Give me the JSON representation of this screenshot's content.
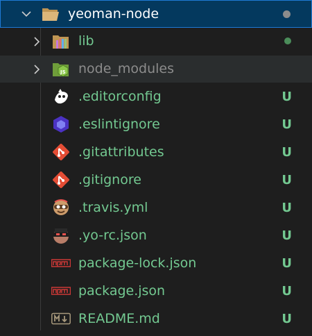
{
  "colors": {
    "modified": "#73c991",
    "ignored": "#8c8c8c",
    "root_text": "#ffffff",
    "selection": "#04395e",
    "focus_border": "#1e7ad6",
    "folder": "#dcb67a"
  },
  "root": {
    "label": "yeoman-node",
    "icon": "folder-open-icon"
  },
  "items": [
    {
      "label": "lib",
      "type": "folder",
      "icon": "lib-folder-icon",
      "status": "",
      "dot": true
    },
    {
      "label": "node_modules",
      "type": "folder",
      "icon": "nodejs-folder-icon",
      "status": "",
      "dot": false
    },
    {
      "label": ".editorconfig",
      "type": "file",
      "icon": "editorconfig-icon",
      "status": "U"
    },
    {
      "label": ".eslintignore",
      "type": "file",
      "icon": "eslint-icon",
      "status": "U"
    },
    {
      "label": ".gitattributes",
      "type": "file",
      "icon": "git-icon",
      "status": "U"
    },
    {
      "label": ".gitignore",
      "type": "file",
      "icon": "git-icon",
      "status": "U"
    },
    {
      "label": ".travis.yml",
      "type": "file",
      "icon": "travis-icon",
      "status": "U"
    },
    {
      "label": ".yo-rc.json",
      "type": "file",
      "icon": "yeoman-icon",
      "status": "U"
    },
    {
      "label": "package-lock.json",
      "type": "file",
      "icon": "npm-icon",
      "status": "U"
    },
    {
      "label": "package.json",
      "type": "file",
      "icon": "npm-icon",
      "status": "U"
    },
    {
      "label": "README.md",
      "type": "file",
      "icon": "markdown-icon",
      "status": "U"
    }
  ]
}
